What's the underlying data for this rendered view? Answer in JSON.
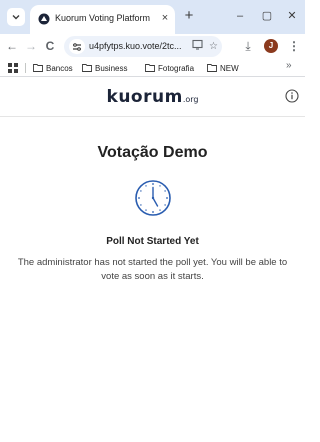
{
  "browser": {
    "tab": {
      "title": "Kuorum Voting Platform",
      "close_label": "×"
    },
    "new_tab_label": "+",
    "window": {
      "minimize": "–",
      "maximize": "▢",
      "close": "✕"
    },
    "toolbar": {
      "back": "←",
      "forward": "→",
      "reload": "C",
      "url": "u4pfytps.kuo.vote/2tc...",
      "download": "⤓",
      "profile_initial": "J",
      "menu": "⋮"
    },
    "bookmarks": [
      {
        "label": "Bancos"
      },
      {
        "label": "Business"
      },
      {
        "label": "Fotografia"
      },
      {
        "label": "NEW"
      }
    ],
    "bookmarks_more": "»"
  },
  "header": {
    "logo_main": "kuorum",
    "logo_suffix": ".org"
  },
  "poll": {
    "title": "Votação Demo",
    "status_heading": "Poll Not Started Yet",
    "status_message": "The administrator has not started the poll yet. You will be able to vote as soon as it starts."
  },
  "colors": {
    "tabstrip_bg": "#dbe6f6",
    "omnibox_bg": "#edf2fa",
    "clock_accent": "#2a5db0",
    "logo": "#1c2438"
  }
}
